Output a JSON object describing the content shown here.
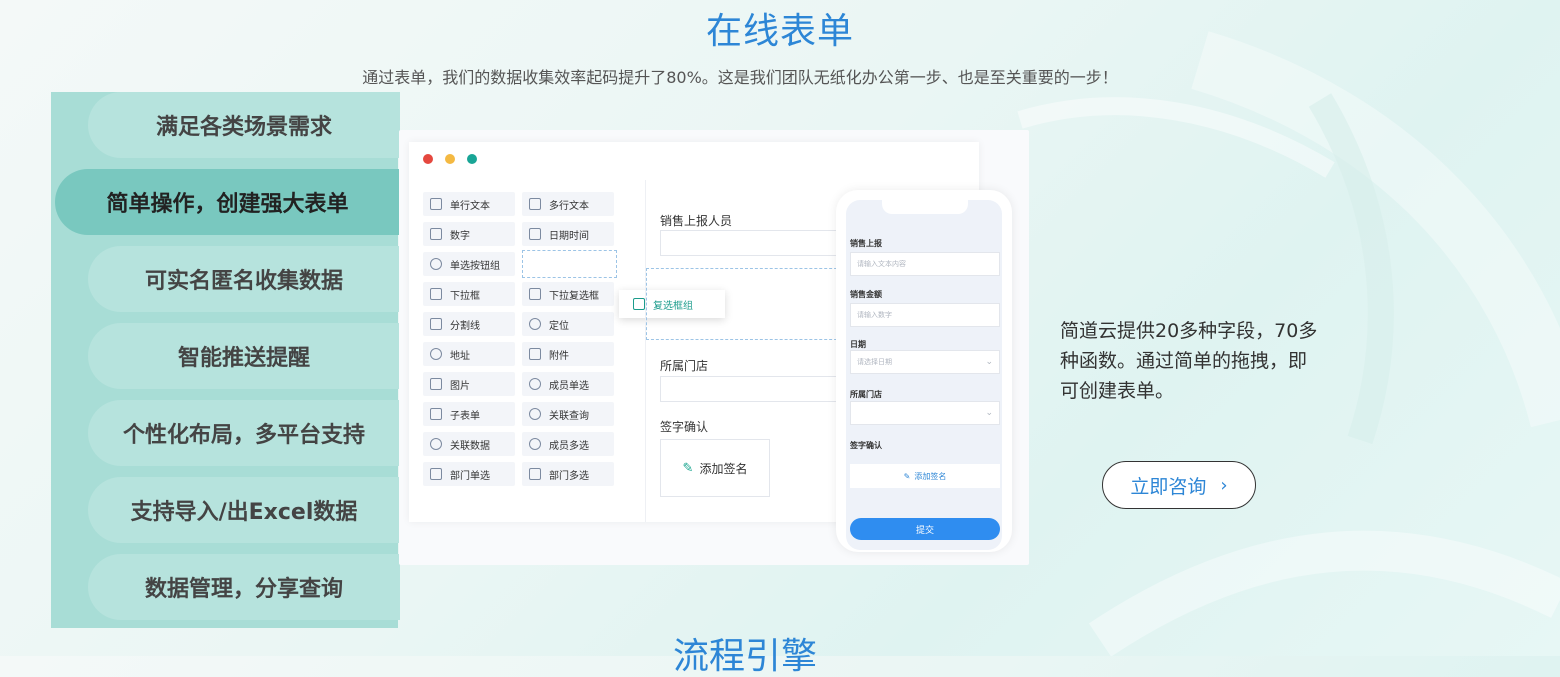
{
  "section": {
    "title": "在线表单",
    "subtitle": "通过表单，我们的数据收集效率起码提升了80%。这是我们团队无纸化办公第一步、也是至关重要的一步！",
    "next_title": "流程引擎"
  },
  "tabs": [
    {
      "label": "满足各类场景需求",
      "active": false
    },
    {
      "label": "简单操作，创建强大表单",
      "active": true
    },
    {
      "label": "可实名匿名收集数据",
      "active": false
    },
    {
      "label": "智能推送提醒",
      "active": false
    },
    {
      "label": "个性化布局，多平台支持",
      "active": false
    },
    {
      "label": "支持导入/出Excel数据",
      "active": false
    },
    {
      "label": "数据管理，分享查询",
      "active": false
    }
  ],
  "window_dots": [
    "#e5483f",
    "#f4b942",
    "#19a596"
  ],
  "palette": [
    {
      "label": "单行文本",
      "icon": "text-field-icon"
    },
    {
      "label": "多行文本",
      "icon": "textarea-icon"
    },
    {
      "label": "数字",
      "icon": "number-icon"
    },
    {
      "label": "日期时间",
      "icon": "calendar-icon"
    },
    {
      "label": "单选按钮组",
      "icon": "radio-icon"
    },
    {
      "label": "",
      "icon": ""
    },
    {
      "label": "下拉框",
      "icon": "dropdown-icon"
    },
    {
      "label": "下拉复选框",
      "icon": "dropdown-checkbox-icon"
    },
    {
      "label": "分割线",
      "icon": "divider-icon"
    },
    {
      "label": "定位",
      "icon": "location-icon"
    },
    {
      "label": "地址",
      "icon": "address-icon"
    },
    {
      "label": "附件",
      "icon": "attachment-icon"
    },
    {
      "label": "图片",
      "icon": "image-icon"
    },
    {
      "label": "成员单选",
      "icon": "member-icon"
    },
    {
      "label": "子表单",
      "icon": "subform-icon"
    },
    {
      "label": "关联查询",
      "icon": "link-query-icon"
    },
    {
      "label": "关联数据",
      "icon": "link-data-icon"
    },
    {
      "label": "成员多选",
      "icon": "members-icon"
    },
    {
      "label": "部门单选",
      "icon": "department-icon"
    },
    {
      "label": "部门多选",
      "icon": "departments-icon"
    }
  ],
  "drag_chip": "复选框组",
  "form_fields": {
    "reporter": "销售上报人员",
    "store": "所属门店",
    "signature": "签字确认",
    "add_signature": "添加签名"
  },
  "phone": {
    "f1_label": "销售上报",
    "f1_placeholder": "请输入文本内容",
    "f2_label": "销售金额",
    "f2_placeholder": "请输入数字",
    "f3_label": "日期",
    "f3_placeholder": "请选择日期",
    "f4_label": "所属门店",
    "f5_label": "签字确认",
    "add_signature": "添加签名",
    "submit": "提交"
  },
  "description": "简道云提供20多种字段，70多种函数。通过简单的拖拽，即可创建表单。",
  "cta_label": "立即咨询"
}
